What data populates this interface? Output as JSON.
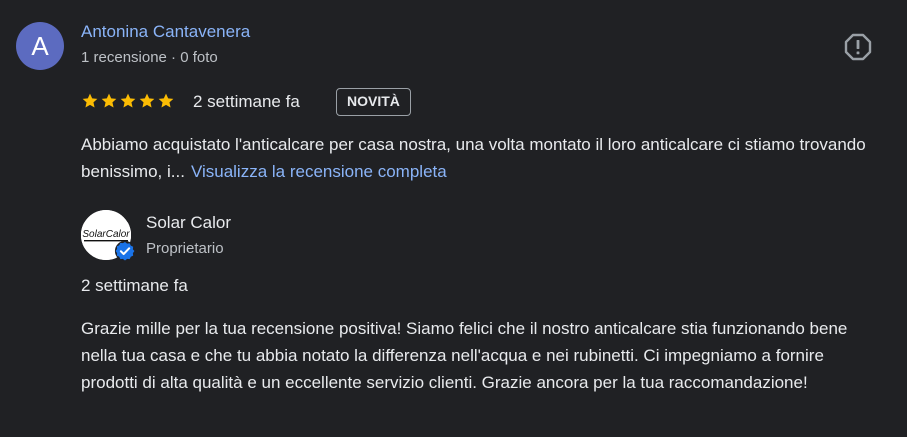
{
  "review": {
    "author": {
      "initial": "A",
      "name": "Antonina Cantavenera",
      "meta": "1 recensione · 0 foto",
      "avatar_color": "#5c6bc0"
    },
    "rating": 5,
    "date": "2 settimane fa",
    "badge": "NOVITÀ",
    "text": "Abbiamo acquistato l'anticalcare per casa nostra, una volta montato il loro anticalcare ci stiamo trovando benissimo, i...",
    "read_more": "Visualizza la recensione completa",
    "report_icon": "report-flag-icon"
  },
  "owner_reply": {
    "name": "Solar Calor",
    "role": "Proprietario",
    "logo_text": "SolarCalor",
    "verified_icon": "verified-check-icon",
    "date": "2 settimane fa",
    "text": "Grazie mille per la tua recensione positiva! Siamo felici che il nostro anticalcare stia funzionando bene nella tua casa e che tu abbia notato la differenza nell'acqua e nei rubinetti. Ci impegniamo a fornire prodotti di alta qualità e un eccellente servizio clienti. Grazie ancora per la tua raccomandazione!"
  },
  "colors": {
    "background": "#202124",
    "link": "#8ab4f8",
    "star": "#fbbc04",
    "verified": "#1a73e8"
  }
}
